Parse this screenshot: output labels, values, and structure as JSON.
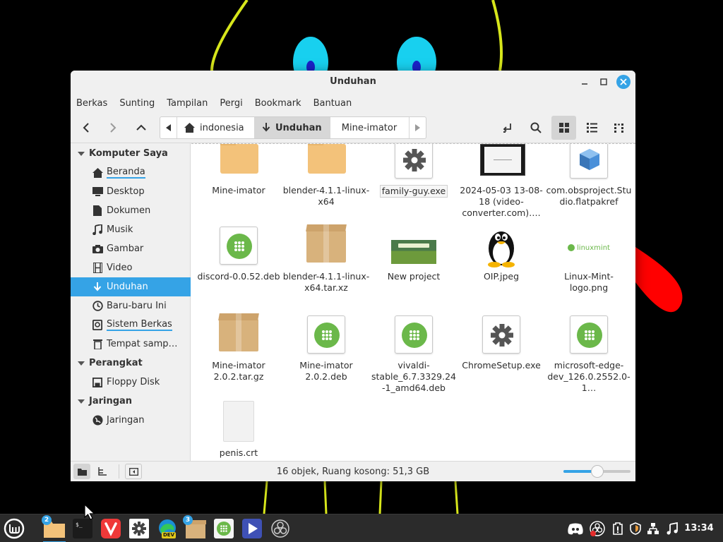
{
  "colors": {
    "accent": "#35a3e6",
    "folder": "#f3c27a",
    "green": "#6bb84a",
    "wallpaper_line": "#d7e61b",
    "wallpaper_eye": "#18d0ef"
  },
  "window": {
    "title": "Unduhan"
  },
  "menubar": [
    "Berkas",
    "Sunting",
    "Tampilan",
    "Pergi",
    "Bookmark",
    "Bantuan"
  ],
  "pathbar": {
    "home": "indonesia",
    "current": "Unduhan",
    "next": "Mine-imator"
  },
  "sidebar": {
    "sections": [
      {
        "label": "Komputer Saya"
      },
      {
        "label": "Perangkat"
      },
      {
        "label": "Jaringan"
      }
    ],
    "items": [
      {
        "label": "Beranda",
        "icon": "home-icon"
      },
      {
        "label": "Desktop",
        "icon": "desktop-icon"
      },
      {
        "label": "Dokumen",
        "icon": "document-icon"
      },
      {
        "label": "Musik",
        "icon": "music-icon"
      },
      {
        "label": "Gambar",
        "icon": "camera-icon"
      },
      {
        "label": "Video",
        "icon": "film-icon"
      },
      {
        "label": "Unduhan",
        "icon": "download-icon"
      },
      {
        "label": "Baru-baru Ini",
        "icon": "clock-icon"
      },
      {
        "label": "Sistem Berkas",
        "icon": "drive-icon"
      },
      {
        "label": "Tempat samp…",
        "icon": "trash-icon"
      },
      {
        "label": "Floppy Disk",
        "icon": "floppy-icon"
      },
      {
        "label": "Jaringan",
        "icon": "network-icon"
      }
    ]
  },
  "files": [
    {
      "name": "Mine-imator",
      "type": "folder"
    },
    {
      "name": "blender-4.1.1-linux-x64",
      "type": "folder"
    },
    {
      "name": "family-guy.exe",
      "type": "exe"
    },
    {
      "name": "2024-05-03 13-08-18 (video-converter.com)….",
      "type": "video"
    },
    {
      "name": "com.obsproject.Studio.flatpakref",
      "type": "flatpakref"
    },
    {
      "name": "discord-0.0.52.deb",
      "type": "deb"
    },
    {
      "name": "blender-4.1.1-linux-x64.tar.xz",
      "type": "archive"
    },
    {
      "name": "New project",
      "type": "image"
    },
    {
      "name": "OIP.jpeg",
      "type": "image"
    },
    {
      "name": "Linux-Mint-logo.png",
      "type": "image"
    },
    {
      "name": "Mine-imator 2.0.2.tar.gz",
      "type": "archive"
    },
    {
      "name": "Mine-imator 2.0.2.deb",
      "type": "deb"
    },
    {
      "name": "vivaldi-stable_6.7.3329.24-1_amd64.deb",
      "type": "deb"
    },
    {
      "name": "ChromeSetup.exe",
      "type": "exe"
    },
    {
      "name": "microsoft-edge-dev_126.0.2552.0-1…",
      "type": "deb"
    },
    {
      "name": "penis.crt",
      "type": "document"
    }
  ],
  "thumbs": {
    "linuxmint_text": "linuxmint"
  },
  "statusbar": {
    "text": "16 objek, Ruang kosong: 51,3 GB",
    "zoom_fraction": 0.5
  },
  "taskbar": {
    "badges": {
      "files": "2",
      "edge": "3"
    },
    "edge_label": "DEV",
    "clock": "13:34"
  }
}
